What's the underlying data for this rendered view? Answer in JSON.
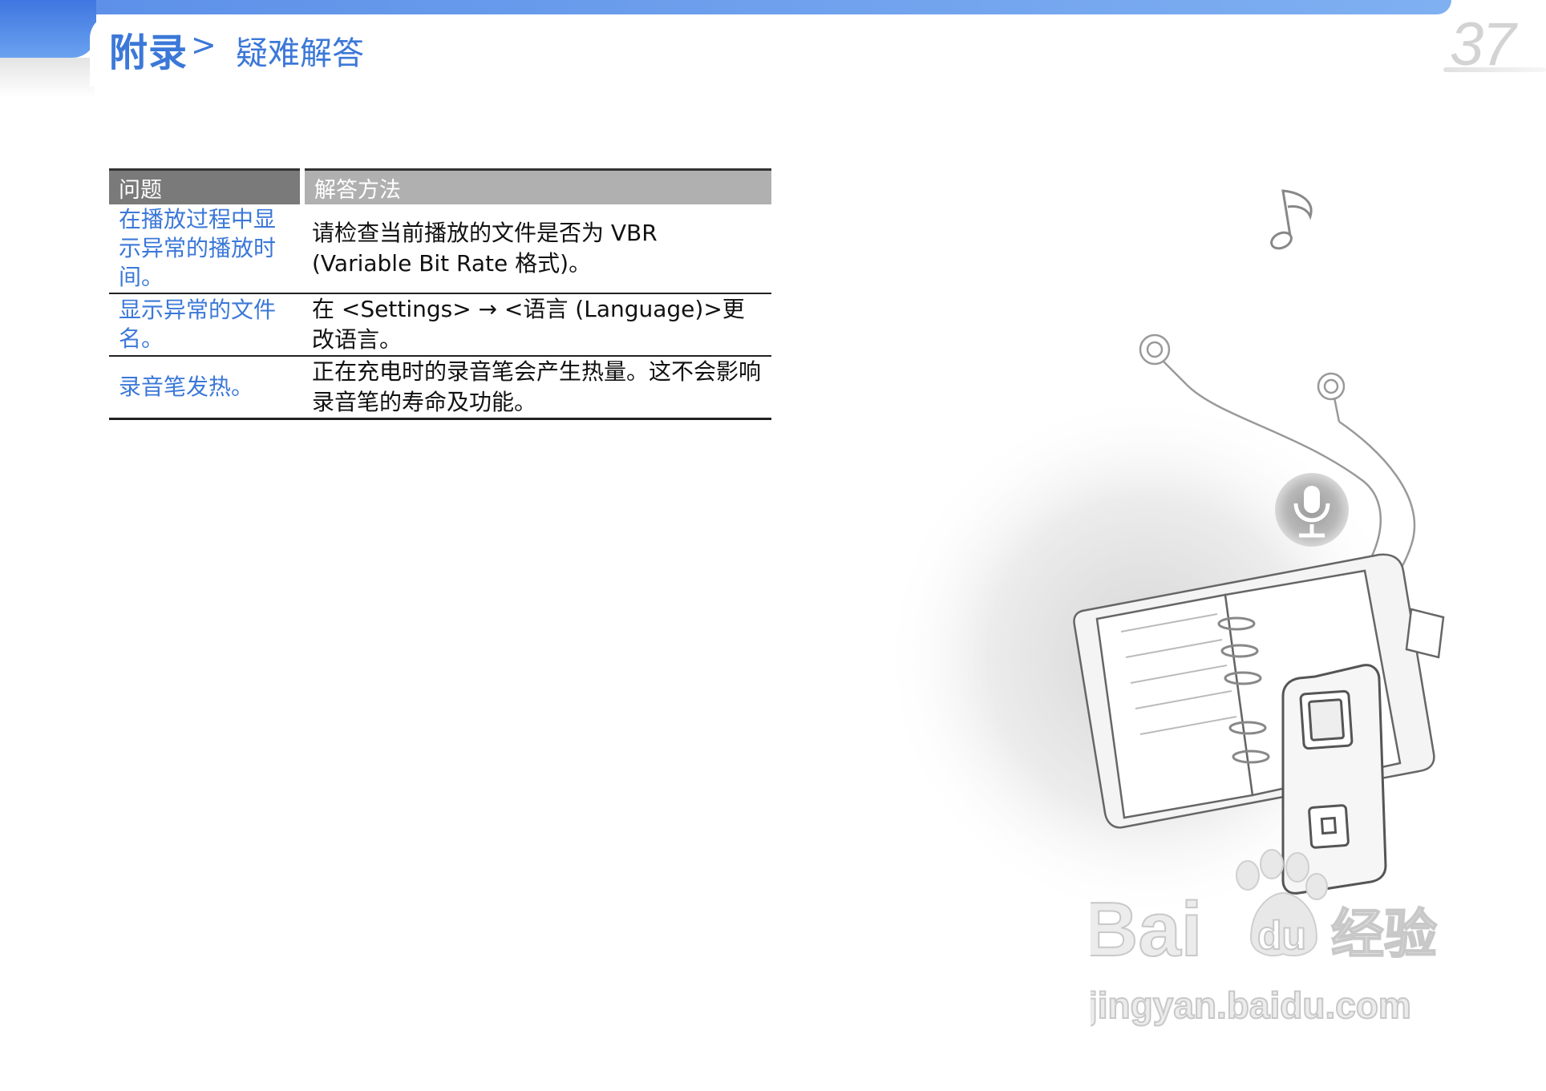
{
  "header": {
    "section": "附录",
    "separator": ">",
    "subsection": "疑难解答",
    "page_number": "37"
  },
  "table": {
    "headers": [
      "问题",
      "解答方法"
    ],
    "rows": [
      {
        "problem": "在播放过程中显示异常的播放时间。",
        "solution": "请检查当前播放的文件是否为 VBR (Variable Bit Rate 格式)。"
      },
      {
        "problem": "显示异常的文件名。",
        "solution": "在 <Settings> → <语言 (Language)>更改语言。"
      },
      {
        "problem": "录音笔发热。",
        "solution": "正在充电时的录音笔会产生热量。这不会影响录音笔的寿命及功能。"
      }
    ]
  },
  "illustration": {
    "icons": [
      "music-note-icon",
      "earphones-icon",
      "microphone-icon",
      "planner-book-icon",
      "voice-recorder-icon"
    ]
  },
  "watermark": {
    "brand_latin": "Bai",
    "brand_du": "du",
    "brand_cn": "经验",
    "url": "jingyan.baidu.com"
  }
}
